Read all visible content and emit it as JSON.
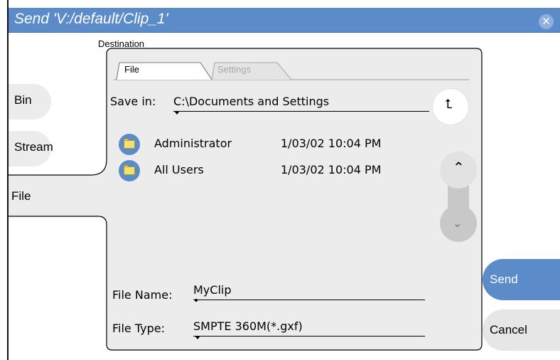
{
  "window": {
    "title": "Send 'V:/default/Clip_1'",
    "close_glyph": "✕"
  },
  "destination": {
    "label": "Destination"
  },
  "side_nav": {
    "items": [
      {
        "label": "Bin"
      },
      {
        "label": "Stream"
      },
      {
        "label": "File"
      }
    ],
    "selected": "File"
  },
  "tabs": [
    {
      "label": "File",
      "active": true
    },
    {
      "label": "Settings",
      "active": false
    }
  ],
  "save_in": {
    "label": "Save in:",
    "value": "C:\\Documents and Settings"
  },
  "up_dir_glyph": "⮤",
  "files": [
    {
      "name": "Administrator",
      "date": "1/03/02 10:04 PM",
      "icon": "folder-icon"
    },
    {
      "name": "All Users",
      "date": "1/03/02 10:04 PM",
      "icon": "folder-icon"
    }
  ],
  "scroll": {
    "up_glyph": "⌃",
    "down_glyph": "⌄"
  },
  "file_name": {
    "label": "File Name:",
    "value": "MyClip"
  },
  "file_type": {
    "label": "File Type:",
    "value": "SMPTE 360M(*.gxf)"
  },
  "actions": {
    "send_label": "Send",
    "cancel_label": "Cancel"
  },
  "colors": {
    "accent": "#5b8cc9",
    "panel_bg": "#ececec",
    "scroll_active": "#e2e2e2",
    "scroll_disabled": "#c8c8c8"
  }
}
